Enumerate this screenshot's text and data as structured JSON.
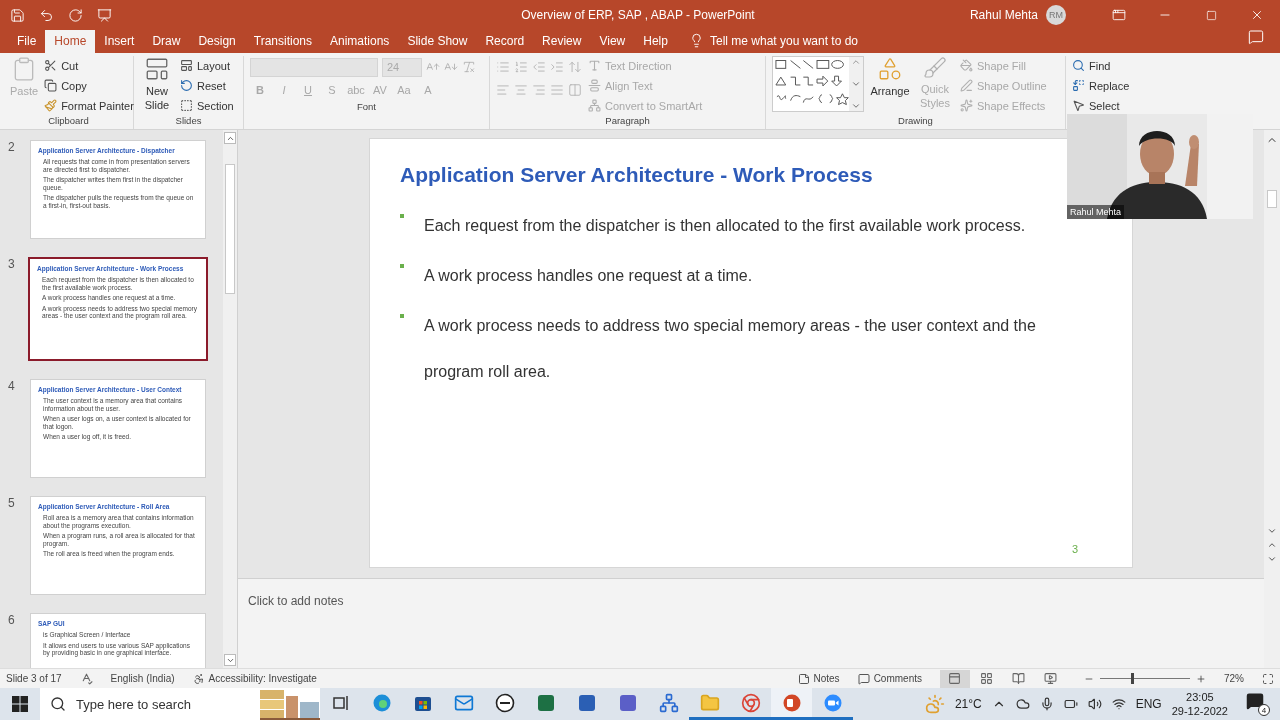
{
  "window": {
    "title": "Overview of ERP, SAP , ABAP  -  PowerPoint",
    "user": "Rahul Mehta",
    "initials": "RM"
  },
  "menu_tabs": [
    {
      "label": "File",
      "selected": false
    },
    {
      "label": "Home",
      "selected": true
    },
    {
      "label": "Insert",
      "selected": false
    },
    {
      "label": "Draw",
      "selected": false
    },
    {
      "label": "Design",
      "selected": false
    },
    {
      "label": "Transitions",
      "selected": false
    },
    {
      "label": "Animations",
      "selected": false
    },
    {
      "label": "Slide Show",
      "selected": false
    },
    {
      "label": "Record",
      "selected": false
    },
    {
      "label": "Review",
      "selected": false
    },
    {
      "label": "View",
      "selected": false
    },
    {
      "label": "Help",
      "selected": false
    }
  ],
  "tell_me": "Tell me what you want to do",
  "ribbon": {
    "clipboard": {
      "label": "Clipboard",
      "paste": "Paste",
      "paste_disabled": true,
      "cut": "Cut",
      "copy": "Copy",
      "format_painter": "Format Painter"
    },
    "slides": {
      "label": "Slides",
      "new_slide": "New Slide",
      "layout": "Layout",
      "reset": "Reset",
      "section": "Section"
    },
    "font": {
      "label": "Font",
      "disabled": true,
      "size": "24",
      "styles": [
        "B",
        "I",
        "U",
        "S",
        "abc",
        "AV",
        "Aa",
        "A"
      ]
    },
    "paragraph": {
      "label": "Paragraph",
      "disabled": true,
      "text_direction": "Text Direction",
      "align_text": "Align Text",
      "convert": "Convert to SmartArt"
    },
    "drawing": {
      "label": "Drawing",
      "arrange": "Arrange",
      "styles_disabled": true,
      "quick_styles": "Quick Styles",
      "shape_fill": "Shape Fill",
      "shape_outline": "Shape Outline",
      "shape_effects": "Shape Effects"
    },
    "editing": {
      "find": "Find",
      "replace": "Replace",
      "select": "Select"
    }
  },
  "thumbnails": [
    {
      "number": "2",
      "selected": false,
      "title": "Application Server Architecture - Dispatcher",
      "bullets": [
        "All requests that come in from presentation servers are directed first to dispatcher.",
        "The dispatcher writes them first in the dispatcher queue.",
        "The dispatcher pulls the requests from the queue on a first-in, first-out basis."
      ]
    },
    {
      "number": "3",
      "selected": true,
      "title": "Application Server Architecture - Work Process",
      "bullets": [
        "Each request from the dispatcher is then allocated to the first available work process.",
        "A work process handles one request at a time.",
        "A work process needs to address two special memory areas - the user context and the program roll area."
      ]
    },
    {
      "number": "4",
      "selected": false,
      "title": "Application Server Architecture - User Context",
      "bullets": [
        "The user context is a memory area that contains information about the user.",
        "When a user logs on, a user context is allocated for that logon.",
        "When a user log off, it is freed."
      ]
    },
    {
      "number": "5",
      "selected": false,
      "title": "Application Server Architecture - Roll Area",
      "bullets": [
        "Roll area is a memory area that contains information about the programs execution.",
        "When a program runs, a roll area is allocated for that program.",
        "The roll area is freed when the program ends."
      ]
    },
    {
      "number": "6",
      "selected": false,
      "title": "SAP GUI",
      "bullets": [
        "is Graphical Screen / Interface",
        "It allows end users to use various SAP applications by providing basic in one graphical interface."
      ]
    }
  ],
  "slide": {
    "title": "Application Server Architecture - Work Process",
    "bullets": [
      "Each request from the dispatcher is then allocated to the first available work process.",
      "A work process handles one request at a time.",
      "A work process needs to address two special memory areas - the user context and the program roll area."
    ],
    "page_number": "3"
  },
  "notes": {
    "placeholder": "Click to add notes"
  },
  "webcam": {
    "name": "Rahul Mehta"
  },
  "status_bar": {
    "slide_info": "Slide 3 of 17",
    "language": "English (India)",
    "accessibility": "Accessibility: Investigate",
    "notes": "Notes",
    "comments": "Comments",
    "views": [
      {
        "kind": "normal",
        "selected": true
      },
      {
        "kind": "sorter",
        "selected": false
      },
      {
        "kind": "reading",
        "selected": false
      },
      {
        "kind": "show",
        "selected": false
      }
    ],
    "zoom": {
      "level": 0.35,
      "reading": "72%"
    }
  },
  "taskbar": {
    "search_placeholder": "Type here to search",
    "apps": [
      {
        "kind": "taskview",
        "running": false,
        "selected": false
      },
      {
        "kind": "edge",
        "running": false,
        "selected": false
      },
      {
        "kind": "store",
        "running": false,
        "selected": false
      },
      {
        "kind": "mail",
        "running": false,
        "selected": false
      },
      {
        "kind": "dell",
        "running": false,
        "selected": false
      },
      {
        "kind": "excel",
        "running": false,
        "selected": false
      },
      {
        "kind": "word",
        "running": false,
        "selected": false
      },
      {
        "kind": "teams",
        "running": false,
        "selected": false
      },
      {
        "kind": "network",
        "running": false,
        "selected": false
      },
      {
        "kind": "explorer",
        "running": true,
        "selected": false
      },
      {
        "kind": "chrome",
        "running": true,
        "selected": false
      },
      {
        "kind": "powerpoint",
        "running": true,
        "selected": true
      },
      {
        "kind": "zoom",
        "running": true,
        "selected": false
      }
    ],
    "temperature": "21°C",
    "language": "ENG",
    "time": "23:05",
    "date": "29-12-2022",
    "notifications": "4"
  }
}
